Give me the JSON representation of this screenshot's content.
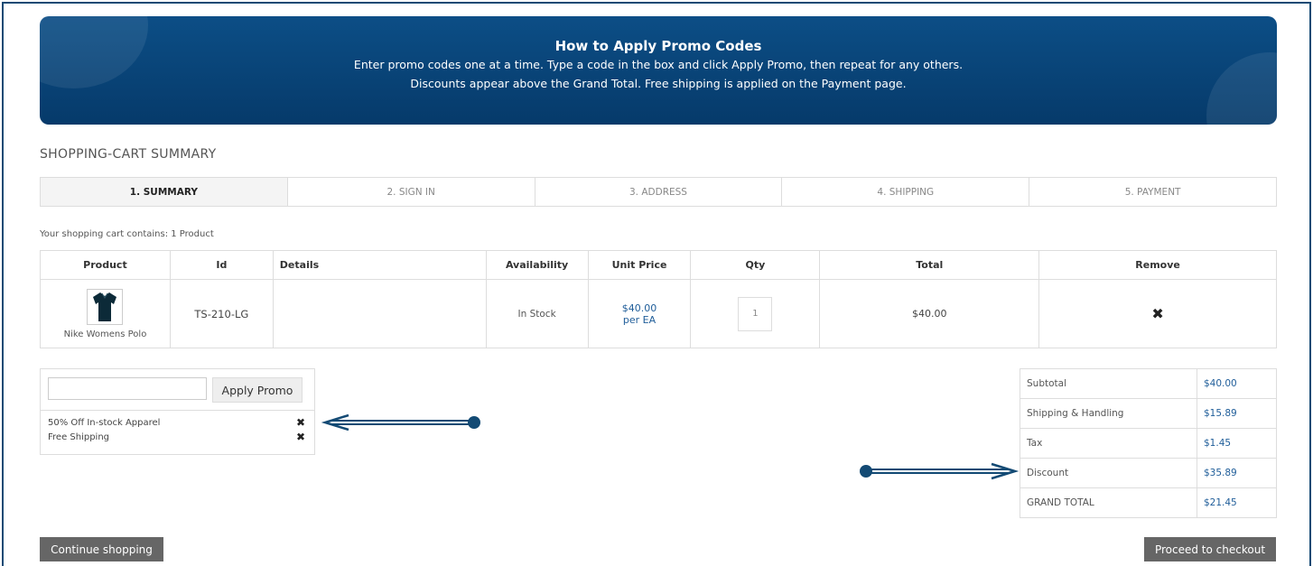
{
  "banner": {
    "title": "How to Apply Promo Codes",
    "line1": "Enter promo codes one at a time. Type a code in the box and click Apply Promo, then repeat for any others.",
    "line2": "Discounts appear above the Grand Total. Free shipping is applied on the Payment page."
  },
  "page_title": "SHOPPING-CART SUMMARY",
  "steps": [
    "1. SUMMARY",
    "2. SIGN IN",
    "3. ADDRESS",
    "4. SHIPPING",
    "5. PAYMENT"
  ],
  "cart_count_text": "Your shopping cart contains: 1 Product",
  "table": {
    "headers": [
      "Product",
      "Id",
      "Details",
      "Availability",
      "Unit Price",
      "Qty",
      "Total",
      "Remove"
    ],
    "rows": [
      {
        "product_name": "Nike Womens Polo",
        "product_icon": "polo-shirt-icon",
        "id": "TS-210-LG",
        "details": "",
        "availability": "In Stock",
        "unit_price": "$40.00",
        "unit_price_unit": "per EA",
        "qty": "1",
        "total": "$40.00"
      }
    ]
  },
  "promo": {
    "input_value": "",
    "apply_label": "Apply Promo",
    "applied": [
      "50% Off In-stock Apparel",
      "Free Shipping"
    ]
  },
  "totals": [
    {
      "label": "Subtotal",
      "value": "$40.00"
    },
    {
      "label": "Shipping & Handling",
      "value": "$15.89"
    },
    {
      "label": "Tax",
      "value": "$1.45"
    },
    {
      "label": "Discount",
      "value": "$35.89"
    },
    {
      "label": "GRAND TOTAL",
      "value": "$21.45"
    }
  ],
  "buttons": {
    "continue": "Continue shopping",
    "checkout": "Proceed to checkout"
  },
  "colors": {
    "banner": "#063a6a",
    "arrow": "#134a74",
    "link": "#1f5d99",
    "button_dark": "#666666"
  }
}
